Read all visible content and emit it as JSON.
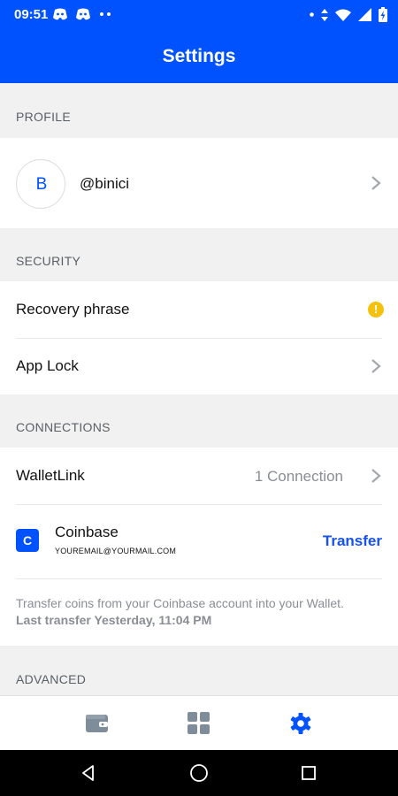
{
  "status_bar": {
    "time": "09:51",
    "left_icons": [
      "discord-icon",
      "discord-icon",
      "more-dots-icon"
    ],
    "right_icons": [
      "dot-icon",
      "data-transfer-icon",
      "wifi-icon",
      "signal-icon",
      "battery-charging-icon"
    ]
  },
  "app_bar": {
    "title": "Settings"
  },
  "profile": {
    "header": "PROFILE",
    "avatar_letter": "B",
    "handle": "@binici"
  },
  "security": {
    "header": "SECURITY",
    "recovery_label": "Recovery phrase",
    "applock_label": "App Lock"
  },
  "connections": {
    "header": "CONNECTIONS",
    "walletlink_label": "WalletLink",
    "walletlink_count": "1 Connection",
    "coinbase_logo_letter": "C",
    "coinbase_name": "Coinbase",
    "coinbase_email": "YOUREMAIL@YOURMAIL.COM",
    "transfer_label": "Transfer",
    "description": "Transfer coins from your Coinbase account into your Wallet.",
    "last_transfer": "Last transfer Yesterday, 11:04 PM"
  },
  "advanced": {
    "header": "ADVANCED"
  },
  "bottom_nav": {
    "items": [
      "wallet-icon",
      "apps-grid-icon",
      "settings-gear-icon"
    ],
    "active": "settings-gear-icon"
  },
  "colors": {
    "brand_blue": "#0052ff",
    "transfer_blue": "#1652f0",
    "warning_yellow": "#f4c20d",
    "inactive_icon": "#7f8c9a"
  }
}
